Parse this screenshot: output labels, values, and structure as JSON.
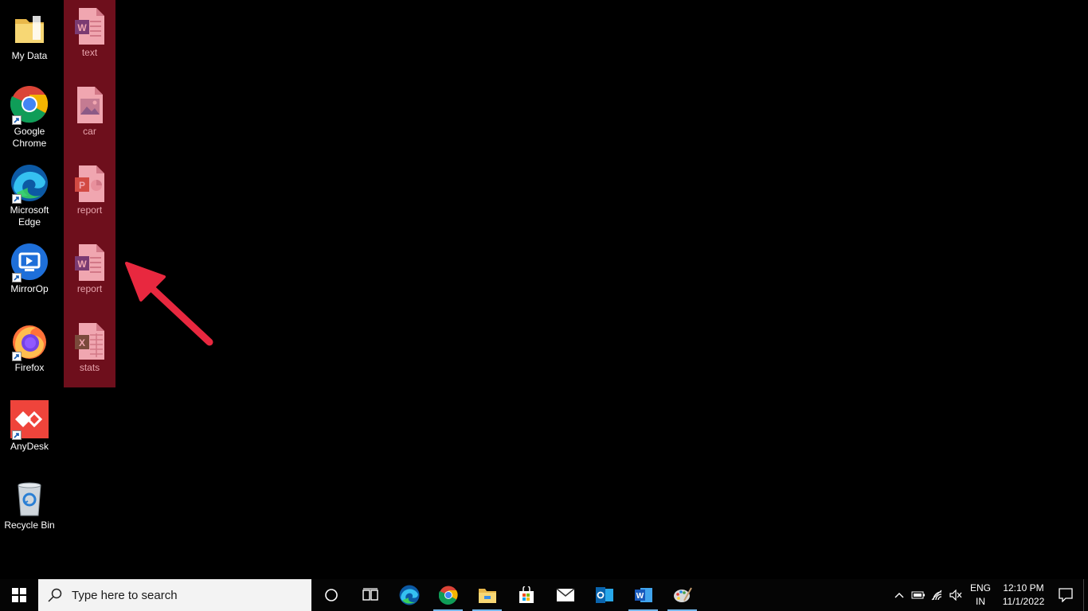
{
  "desktop": {
    "icons": [
      {
        "label": "My Data",
        "icon": "folder-icon"
      },
      {
        "label": "Google Chrome",
        "icon": "chrome-icon"
      },
      {
        "label": "Microsoft Edge",
        "icon": "edge-icon"
      },
      {
        "label": "MirrorOp",
        "icon": "mirrorop-icon"
      },
      {
        "label": "Firefox",
        "icon": "firefox-icon"
      },
      {
        "label": "AnyDesk",
        "icon": "anydesk-icon"
      },
      {
        "label": "Recycle Bin",
        "icon": "recycle-bin-icon"
      }
    ],
    "selected_files": [
      {
        "label": "text",
        "icon": "word-document-icon"
      },
      {
        "label": "car",
        "icon": "image-file-icon"
      },
      {
        "label": "report",
        "icon": "powerpoint-document-icon"
      },
      {
        "label": "report",
        "icon": "word-document-icon"
      },
      {
        "label": "stats",
        "icon": "excel-document-icon"
      }
    ],
    "selection_color": "#6e0f1c",
    "annotation_arrow_color": "#e8283f"
  },
  "taskbar": {
    "search_placeholder": "Type here to search",
    "apps": [
      "cortana-icon",
      "task-view-icon",
      "edge-icon",
      "chrome-icon",
      "file-explorer-icon",
      "microsoft-store-icon",
      "mail-icon",
      "outlook-icon",
      "word-icon",
      "paint-icon"
    ],
    "tray": {
      "lang_line1": "ENG",
      "lang_line2": "IN",
      "time": "12:10 PM",
      "date": "11/1/2022"
    }
  }
}
